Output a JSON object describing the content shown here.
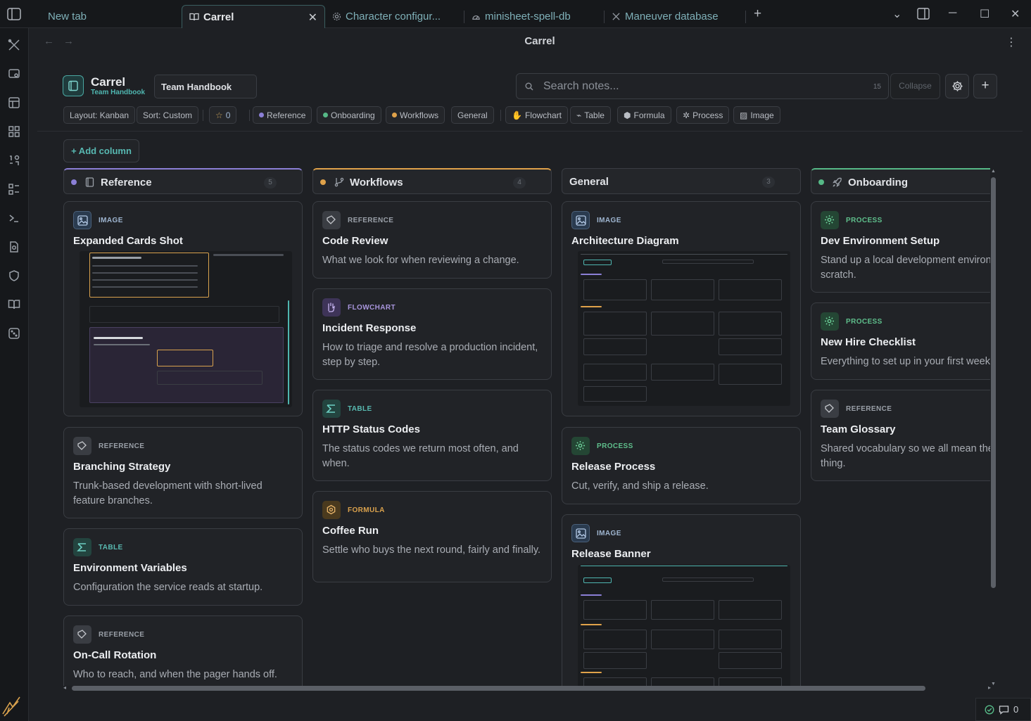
{
  "tabs": [
    {
      "label": "New tab",
      "icon": "none"
    },
    {
      "label": "Carrel",
      "icon": "book-icon",
      "active": true
    },
    {
      "label": "Character configur...",
      "icon": "gear-icon"
    },
    {
      "label": "minisheet-spell-db",
      "icon": "dashboard-icon"
    },
    {
      "label": "Maneuver database",
      "icon": "swords-icon"
    }
  ],
  "page_title": "Carrel",
  "app": {
    "title": "Carrel",
    "subtitle": "Team Handbook",
    "board": "Team Handbook"
  },
  "search": {
    "placeholder": "Search notes...",
    "count": "15"
  },
  "toolbar": {
    "collapse_label": "Collapse",
    "add_label": "+"
  },
  "chips": {
    "layout": "Layout: Kanban",
    "sort": "Sort: Custom",
    "starred": "0",
    "tags": [
      "Reference",
      "Onboarding",
      "Workflows",
      "General"
    ],
    "types": [
      "Flowchart",
      "Table",
      "Formula",
      "Process",
      "Image"
    ]
  },
  "add_column_label": "+ Add column",
  "colors": {
    "reference": "#8b7fd6",
    "onboarding": "#56b987",
    "workflows": "#e0a24a",
    "accent": "#4fb6b0"
  },
  "columns": [
    {
      "name": "Reference",
      "count": "5",
      "cards": [
        {
          "kind": "IMAGE",
          "title": "Expanded Cards Shot"
        },
        {
          "kind": "REFERENCE",
          "title": "Branching Strategy",
          "desc": "Trunk-based development with short-lived feature branches."
        },
        {
          "kind": "TABLE",
          "title": "Environment Variables",
          "desc": "Configuration the service reads at startup."
        },
        {
          "kind": "REFERENCE",
          "title": "On-Call Rotation",
          "desc": "Who to reach, and when the pager hands off."
        }
      ]
    },
    {
      "name": "Workflows",
      "count": "4",
      "cards": [
        {
          "kind": "REFERENCE",
          "title": "Code Review",
          "desc": "What we look for when reviewing a change."
        },
        {
          "kind": "FLOWCHART",
          "title": "Incident Response",
          "desc": "How to triage and resolve a production incident, step by step."
        },
        {
          "kind": "TABLE",
          "title": "HTTP Status Codes",
          "desc": "The status codes we return most often, and when."
        },
        {
          "kind": "FORMULA",
          "title": "Coffee Run",
          "desc": "Settle who buys the next round, fairly and finally."
        }
      ]
    },
    {
      "name": "General",
      "count": "3",
      "cards": [
        {
          "kind": "IMAGE",
          "title": "Architecture Diagram"
        },
        {
          "kind": "PROCESS",
          "title": "Release Process",
          "desc": "Cut, verify, and ship a release."
        },
        {
          "kind": "IMAGE",
          "title": "Release Banner"
        }
      ]
    },
    {
      "name": "Onboarding",
      "count": "",
      "cards": [
        {
          "kind": "PROCESS",
          "title": "Dev Environment Setup",
          "desc": "Stand up a local development environment from scratch."
        },
        {
          "kind": "PROCESS",
          "title": "New Hire Checklist",
          "desc": "Everything to set up in your first week."
        },
        {
          "kind": "REFERENCE",
          "title": "Team Glossary",
          "desc": "Shared vocabulary so we all mean the same thing."
        }
      ]
    }
  ],
  "status": {
    "comments": "0"
  }
}
